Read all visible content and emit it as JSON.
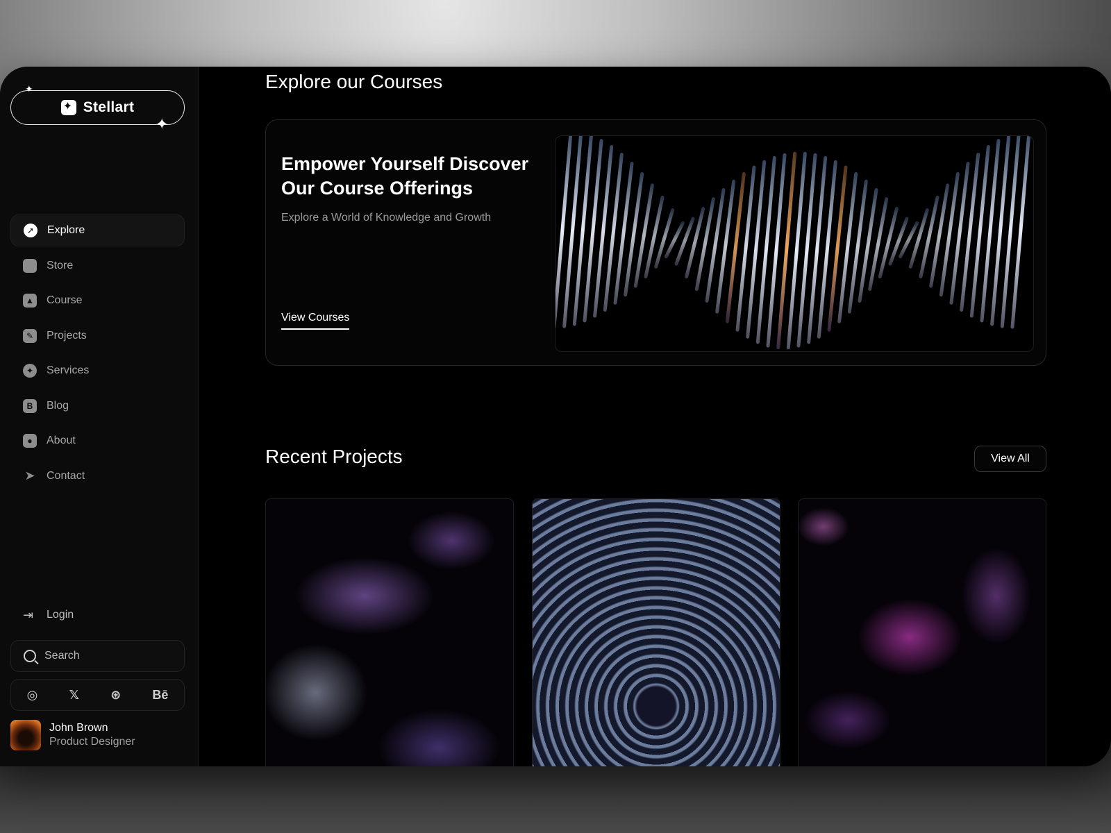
{
  "brand": {
    "name": "Stellart"
  },
  "sidebar": {
    "items": [
      {
        "label": "Explore",
        "icon": "compass-icon",
        "active": true
      },
      {
        "label": "Store",
        "icon": "bag-icon"
      },
      {
        "label": "Course",
        "icon": "graduation-cap-icon"
      },
      {
        "label": "Projects",
        "icon": "edit-icon"
      },
      {
        "label": "Services",
        "icon": "sparkle-icon"
      },
      {
        "label": "Blog",
        "icon": "blog-icon"
      },
      {
        "label": "About",
        "icon": "user-icon"
      },
      {
        "label": "Contact",
        "icon": "send-icon"
      }
    ],
    "login_label": "Login",
    "search_placeholder": "Search",
    "socials": [
      {
        "label": "◎",
        "icon": "instagram-icon"
      },
      {
        "label": "𝕏",
        "icon": "x-icon"
      },
      {
        "label": "⊛",
        "icon": "dribbble-icon"
      },
      {
        "label": "Bē",
        "icon": "behance-icon"
      }
    ],
    "user": {
      "name": "John Brown",
      "role": "Product Designer"
    }
  },
  "main": {
    "courses_title": "Explore our Courses",
    "hero": {
      "heading": "Empower Yourself Discover Our Course Offerings",
      "subheading": "Explore a World of Knowledge and Growth",
      "link": "View Courses"
    },
    "projects_title": "Recent Projects",
    "view_all": "View All"
  },
  "colors": {
    "background": "#000000",
    "sidebar": "#0b0b0b",
    "text": "#ffffff",
    "muted": "#a7a7a7",
    "border": "#262626"
  }
}
